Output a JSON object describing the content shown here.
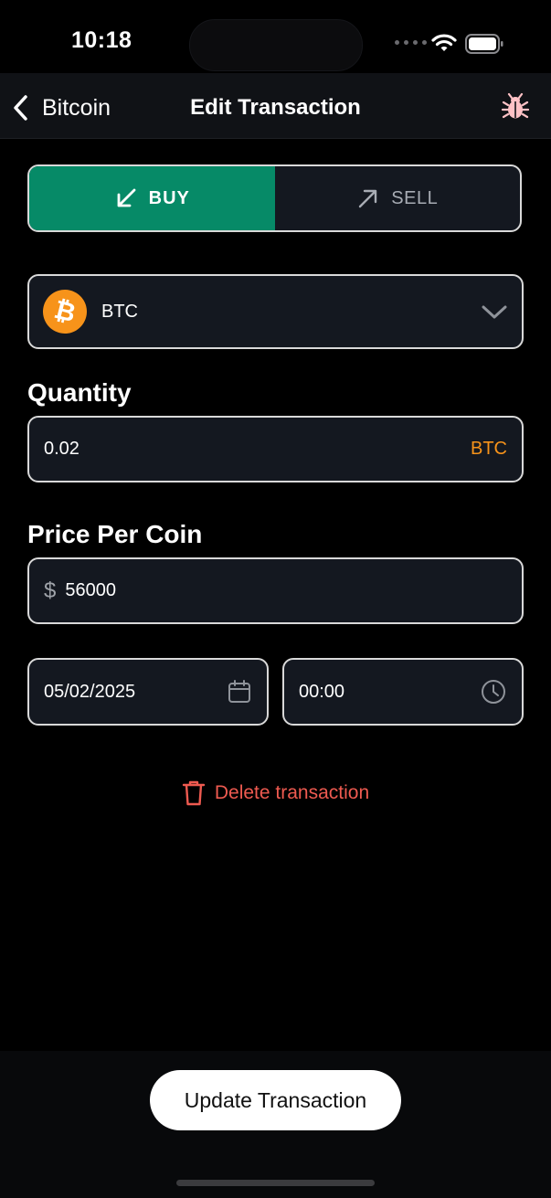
{
  "status": {
    "time": "10:18"
  },
  "nav": {
    "back_label": "Bitcoin",
    "title": "Edit Transaction",
    "debug_icon": "bug-icon"
  },
  "segment": {
    "buy_label": "BUY",
    "sell_label": "SELL",
    "selected": "BUY"
  },
  "coin": {
    "symbol": "BTC",
    "badge": "₿"
  },
  "quantity": {
    "label": "Quantity",
    "value": "0.02",
    "unit": "BTC"
  },
  "price": {
    "label": "Price Per Coin",
    "currency_symbol": "$",
    "value": "56000"
  },
  "date": {
    "value": "05/02/2025"
  },
  "time": {
    "value": "00:00"
  },
  "delete_label": "Delete transaction",
  "update_label": "Update Transaction",
  "colors": {
    "accent_buy": "#068a67",
    "btc_orange": "#f7931a",
    "danger": "#ee5a50"
  }
}
